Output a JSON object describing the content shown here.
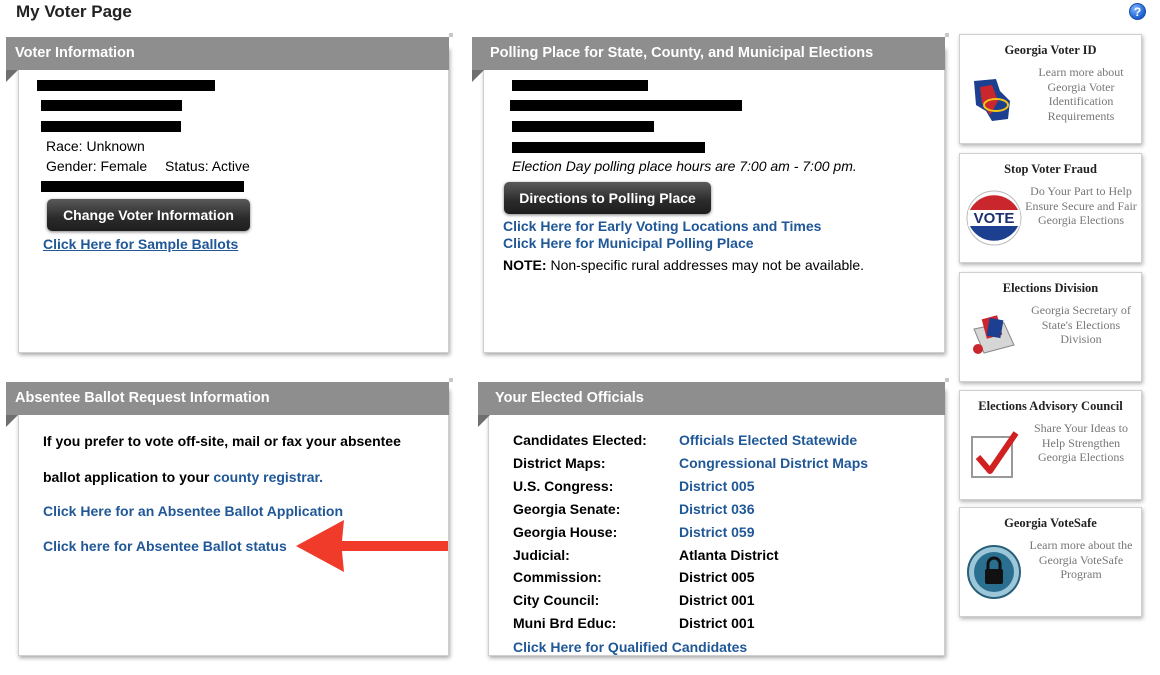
{
  "page": {
    "title": "My Voter Page",
    "help_icon": "?"
  },
  "voter_info": {
    "heading": "Voter Information",
    "race": "Race: Unknown",
    "gender": "Gender: Female",
    "status": "Status: Active",
    "change_button": "Change Voter Information",
    "sample_ballots_link": "Click Here for Sample Ballots"
  },
  "polling_place": {
    "heading": "Polling Place for State, County, and Municipal Elections",
    "hours": "Election Day polling place hours are 7:00 am - 7:00 pm.",
    "directions_button": "Directions to Polling Place",
    "early_voting_link": "Click Here for Early Voting Locations and Times",
    "municipal_link": "Click Here for Municipal Polling Place",
    "note_label": "NOTE:",
    "note_text": " Non-specific rural addresses may not be available."
  },
  "absentee": {
    "heading": "Absentee Ballot Request Information",
    "line1": "If you prefer to vote off-site, mail or fax your absentee",
    "line2_prefix": "ballot application to your ",
    "registrar_link": "county registrar.",
    "application_link": "Click Here for an Absentee Ballot Application",
    "status_link": "Click here for Absentee Ballot status",
    "arrow_color": "#f03a2a"
  },
  "officials": {
    "heading": "Your Elected Officials",
    "rows": [
      {
        "label": "Candidates Elected:",
        "value": "Officials Elected Statewide",
        "link": true
      },
      {
        "label": "District Maps:",
        "value": "Congressional District Maps",
        "link": true
      },
      {
        "label": "U.S. Congress:",
        "value": "District 005",
        "link": true
      },
      {
        "label": "Georgia Senate:",
        "value": "District 036",
        "link": true
      },
      {
        "label": "Georgia House:",
        "value": "District 059",
        "link": true
      },
      {
        "label": "Judicial:",
        "value": "Atlanta District",
        "link": false
      },
      {
        "label": "Commission:",
        "value": "District 005",
        "link": false
      },
      {
        "label": "City Council:",
        "value": "District 001",
        "link": false
      },
      {
        "label": "Muni Brd Educ:",
        "value": "District 001",
        "link": false
      }
    ],
    "qualified_link": "Click Here for Qualified Candidates"
  },
  "sidebar": [
    {
      "title": "Georgia Voter ID",
      "text": "Learn more about Georgia Voter Identification Requirements",
      "icon": "georgia-voter-id-icon"
    },
    {
      "title": "Stop Voter Fraud",
      "text": "Do Your Part to Help Ensure Secure and Fair Georgia Elections",
      "icon": "vote-badge-icon",
      "badge": "VOTE"
    },
    {
      "title": "Elections Division",
      "text": "Georgia Secretary of State's Elections Division",
      "icon": "ballot-box-icon"
    },
    {
      "title": "Elections Advisory Council",
      "text": "Share Your Ideas to Help Strengthen Georgia Elections",
      "icon": "checkmark-icon"
    },
    {
      "title": "Georgia VoteSafe",
      "text": "Learn more about the Georgia VoteSafe Program",
      "icon": "lock-icon"
    }
  ],
  "colors": {
    "header_gray": "#8e8e8e",
    "link_blue": "#1f5797",
    "arrow_red": "#f03a2a"
  }
}
